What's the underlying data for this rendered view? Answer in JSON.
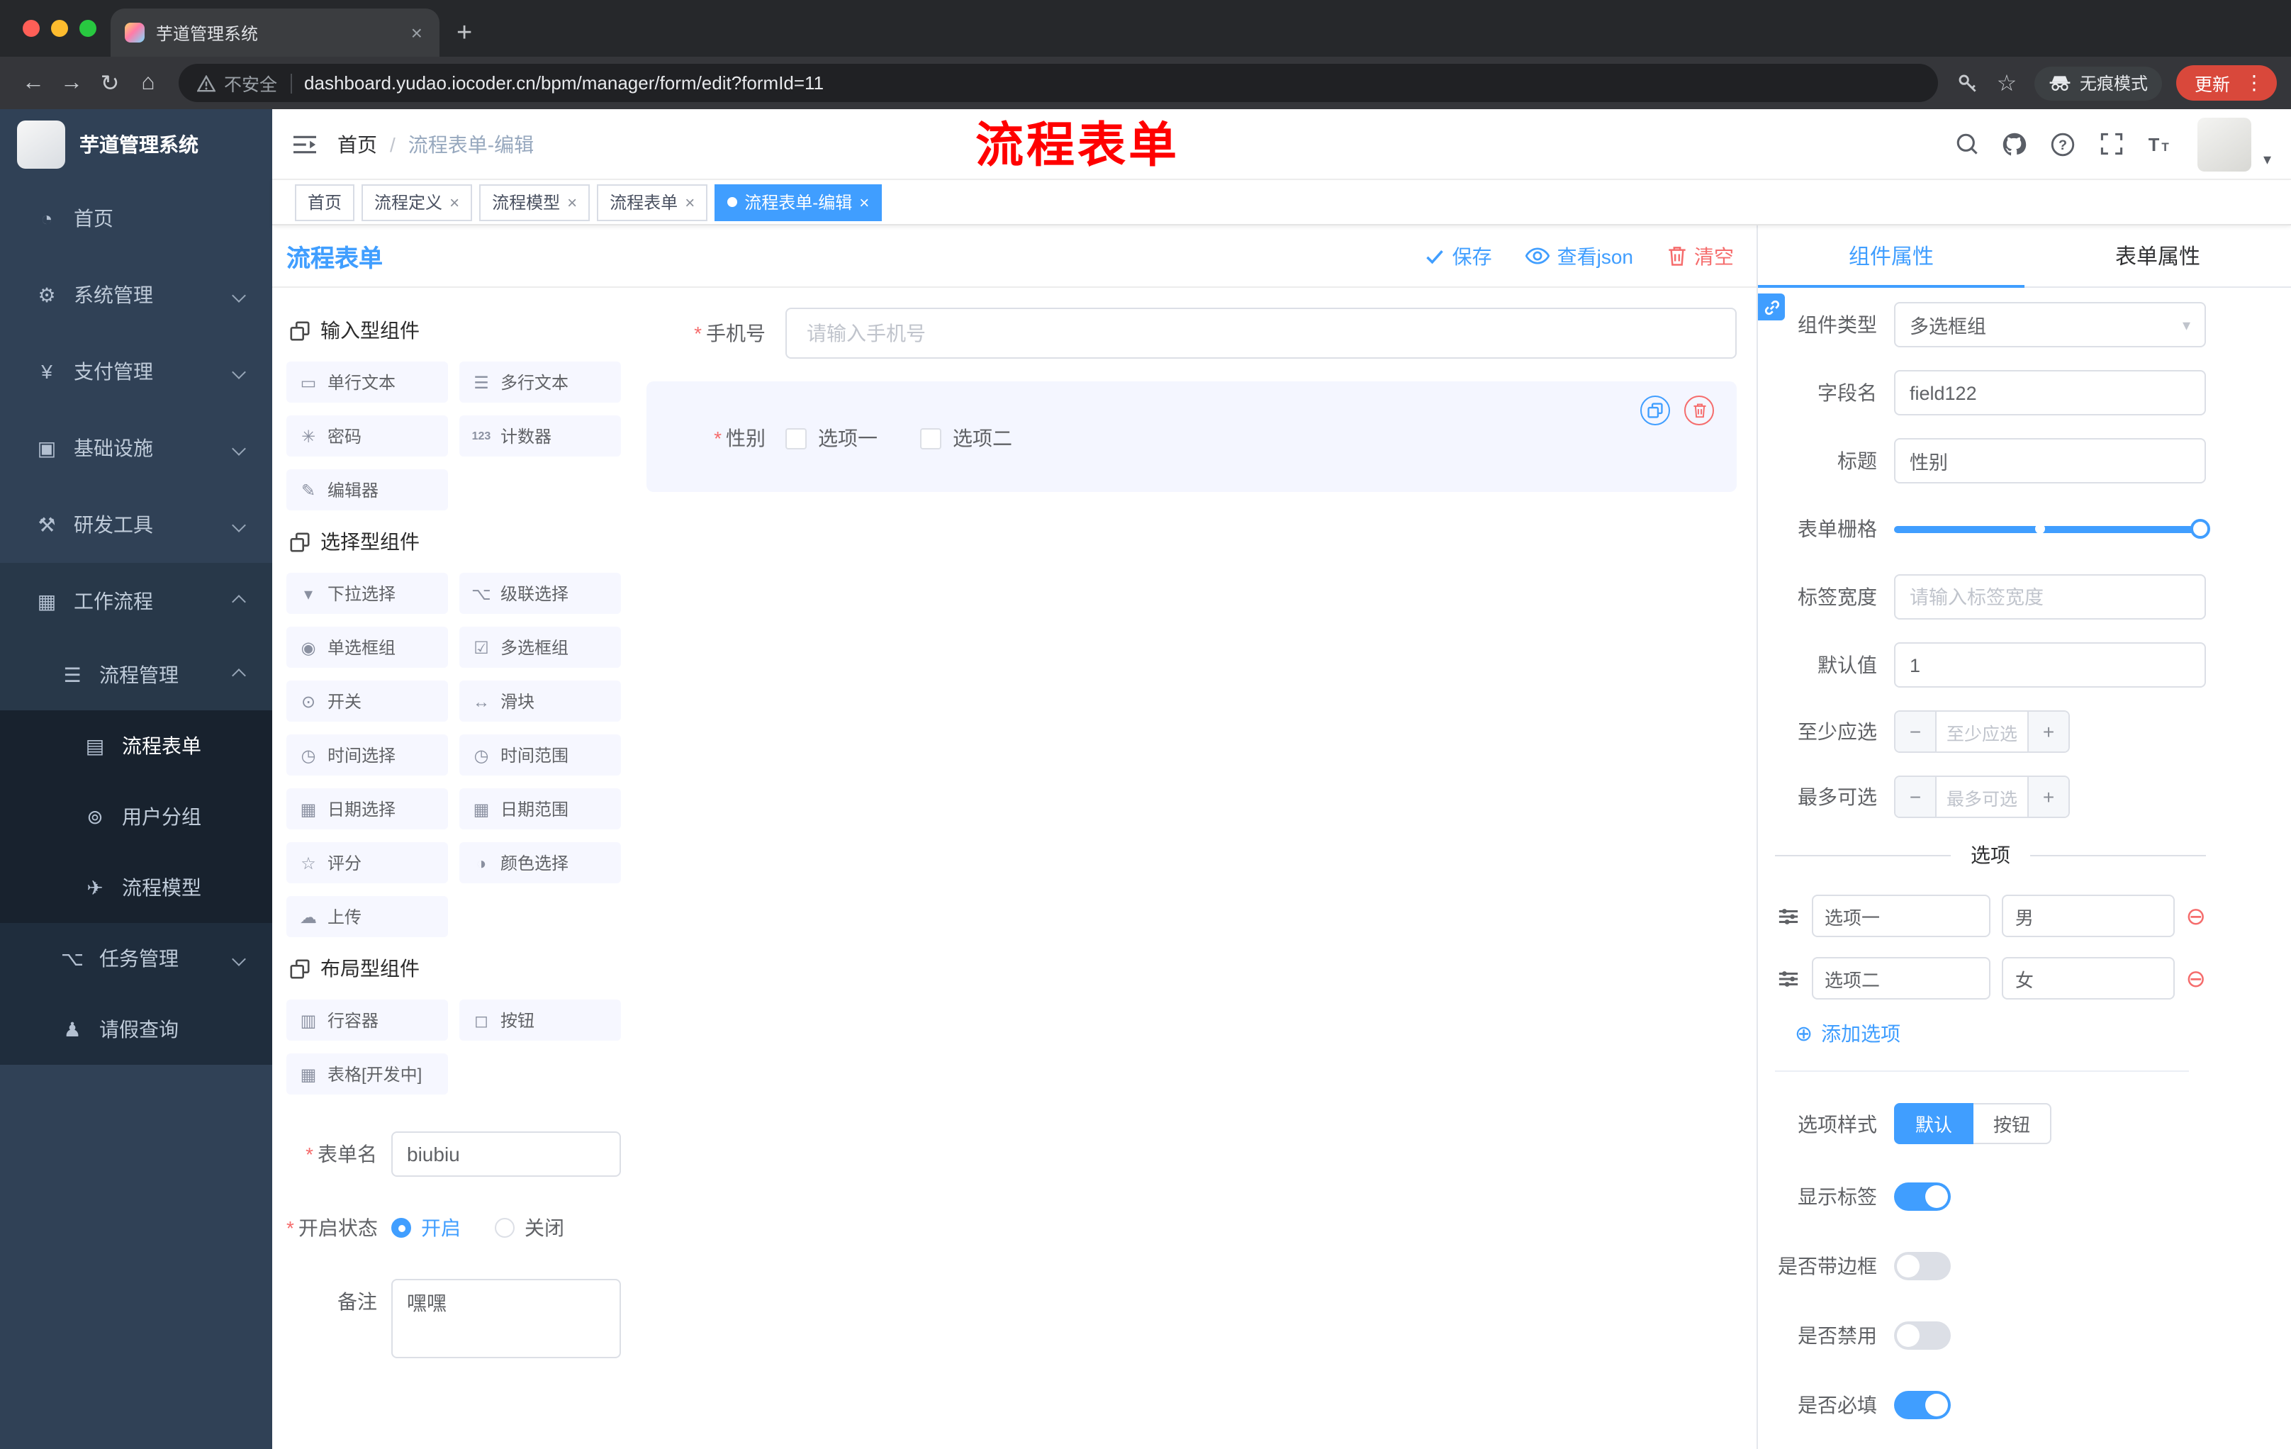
{
  "browser": {
    "tab": {
      "title": "芋道管理系统"
    },
    "address": {
      "security_label": "不安全",
      "url": "dashboard.yudao.iocoder.cn/bpm/manager/form/edit?formId=11"
    },
    "incognito_label": "无痕模式",
    "update_label": "更新"
  },
  "annotation": {
    "text": "流程表单",
    "color": "#ff0000"
  },
  "sidebar": {
    "logo_title": "芋道管理系统",
    "menu": [
      {
        "label": "首页",
        "icon": "dashboard"
      },
      {
        "label": "系统管理",
        "icon": "gear",
        "arrow": "down"
      },
      {
        "label": "支付管理",
        "icon": "pay",
        "arrow": "down"
      },
      {
        "label": "基础设施",
        "icon": "infra",
        "arrow": "down"
      },
      {
        "label": "研发工具",
        "icon": "tools",
        "arrow": "down"
      },
      {
        "label": "工作流程",
        "icon": "workflow",
        "arrow": "up",
        "open": true,
        "children": [
          {
            "label": "流程管理",
            "icon": "process-mgmt",
            "arrow": "up",
            "open": true,
            "children": [
              {
                "label": "流程表单",
                "icon": "form",
                "active": true
              },
              {
                "label": "用户分组",
                "icon": "user-group"
              },
              {
                "label": "流程模型",
                "icon": "model"
              }
            ]
          },
          {
            "label": "任务管理",
            "icon": "task",
            "arrow": "down"
          },
          {
            "label": "请假查询",
            "icon": "leave"
          }
        ]
      }
    ]
  },
  "navbar": {
    "breadcrumb": [
      "首页",
      "流程表单-编辑"
    ]
  },
  "tags_bar": {
    "tags": [
      {
        "label": "首页",
        "closable": false,
        "active": false
      },
      {
        "label": "流程定义",
        "closable": true,
        "active": false
      },
      {
        "label": "流程模型",
        "closable": true,
        "active": false
      },
      {
        "label": "流程表单",
        "closable": true,
        "active": false
      },
      {
        "label": "流程表单-编辑",
        "closable": true,
        "active": true
      }
    ]
  },
  "designer": {
    "title": "流程表单",
    "actions": {
      "save": "保存",
      "view_json": "查看json",
      "clear": "清空"
    },
    "component_groups": [
      {
        "title": "输入型组件",
        "items": [
          {
            "label": "单行文本",
            "icon": "single-text"
          },
          {
            "label": "多行文本",
            "icon": "multi-text"
          },
          {
            "label": "密码",
            "icon": "password"
          },
          {
            "label": "计数器",
            "icon": "counter"
          },
          {
            "label": "编辑器",
            "icon": "editor"
          }
        ]
      },
      {
        "title": "选择型组件",
        "items": [
          {
            "label": "下拉选择",
            "icon": "select"
          },
          {
            "label": "级联选择",
            "icon": "cascader"
          },
          {
            "label": "单选框组",
            "icon": "radio-group"
          },
          {
            "label": "多选框组",
            "icon": "checkbox-group"
          },
          {
            "label": "开关",
            "icon": "switch"
          },
          {
            "label": "滑块",
            "icon": "slider"
          },
          {
            "label": "时间选择",
            "icon": "time"
          },
          {
            "label": "时间范围",
            "icon": "time-range"
          },
          {
            "label": "日期选择",
            "icon": "date"
          },
          {
            "label": "日期范围",
            "icon": "date-range"
          },
          {
            "label": "评分",
            "icon": "rate"
          },
          {
            "label": "颜色选择",
            "icon": "color"
          },
          {
            "label": "上传",
            "icon": "upload"
          }
        ]
      },
      {
        "title": "布局型组件",
        "items": [
          {
            "label": "行容器",
            "icon": "row"
          },
          {
            "label": "按钮",
            "icon": "button"
          },
          {
            "label": "表格[开发中]",
            "icon": "table"
          }
        ]
      }
    ],
    "meta_form": {
      "name_label": "表单名",
      "name_value": "biubiu",
      "status_label": "开启状态",
      "status_options": [
        {
          "label": "开启",
          "checked": true
        },
        {
          "label": "关闭",
          "checked": false
        }
      ],
      "remark_label": "备注",
      "remark_value": "嘿嘿"
    },
    "canvas": {
      "phone_field": {
        "label": "手机号",
        "placeholder": "请输入手机号"
      },
      "gender_field": {
        "label": "性别",
        "options": [
          "选项一",
          "选项二"
        ]
      }
    }
  },
  "props_panel": {
    "tabs": [
      {
        "label": "组件属性",
        "active": true
      },
      {
        "label": "表单属性",
        "active": false
      }
    ],
    "component_type": {
      "label": "组件类型",
      "value": "多选框组"
    },
    "field_name": {
      "label": "字段名",
      "value": "field122"
    },
    "title": {
      "label": "标题",
      "value": "性别"
    },
    "grid": {
      "label": "表单栅格"
    },
    "label_width": {
      "label": "标签宽度",
      "placeholder": "请输入标签宽度"
    },
    "default_value": {
      "label": "默认值",
      "value": "1"
    },
    "min_select": {
      "label": "至少应选",
      "placeholder": "至少应选"
    },
    "max_select": {
      "label": "最多可选",
      "placeholder": "最多可选"
    },
    "options_divider": "选项",
    "options": [
      {
        "label": "选项一",
        "value": "男"
      },
      {
        "label": "选项二",
        "value": "女"
      }
    ],
    "add_option_label": "添加选项",
    "option_style": {
      "label": "选项样式",
      "choices": [
        {
          "label": "默认",
          "active": true
        },
        {
          "label": "按钮",
          "active": false
        }
      ]
    },
    "switches": [
      {
        "label": "显示标签",
        "on": true
      },
      {
        "label": "是否带边框",
        "on": false
      },
      {
        "label": "是否禁用",
        "on": false
      },
      {
        "label": "是否必填",
        "on": true
      }
    ]
  },
  "colors": {
    "accent": "#409eff",
    "danger": "#f56c6c",
    "sidebar_bg": "#304156",
    "active_tag": "#409eff"
  }
}
